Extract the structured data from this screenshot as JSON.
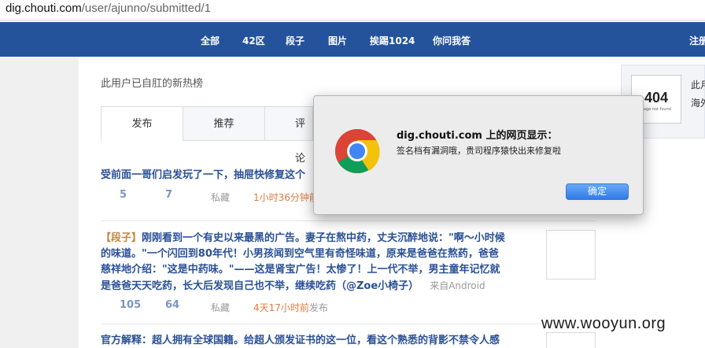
{
  "address_bar": {
    "host": "dig.chouti.com",
    "path": "/user/ajunno/submitted/1"
  },
  "nav": {
    "items": [
      "全部",
      "42区",
      "段子",
      "图片",
      "挨踢1024",
      "你问我答"
    ],
    "right_item": "注册"
  },
  "page": {
    "title": "此用户已自肛的新热榜",
    "tabs": [
      "发布",
      "推荐",
      "评论"
    ]
  },
  "posts": [
    {
      "title": "受前面一哥们启发玩了一下，抽屉快修复这个",
      "upvotes": "5",
      "comments": "7",
      "save": "私藏",
      "time": "1小时36分钟前"
    },
    {
      "tag": "【段子】",
      "title_lines": [
        "刚刚看到一个有史以来最黑的广告。妻子在熬中药，丈夫沉醉地说：\"啊～小时候",
        "的味道。\"一个闪回到80年代！小男孩闻到空气里有奇怪味道，原来是爸爸在熬药，爸爸",
        "慈祥地介绍：\"这是中药味。\"——这是肾宝广告！太惨了！上一代不举，男主童年记忆就",
        "是爸爸天天吃药，长大后发现自己也不举，继续吃药（@Zoe小椅子）"
      ],
      "source": "来自Android",
      "upvotes": "105",
      "comments": "64",
      "save": "私藏",
      "time": "4天17小时前",
      "time_suffix": "发布"
    },
    {
      "title": "官方解释：超人拥有全球国籍。给超人颁发证书的这一位，看这个熟悉的背影不禁令人感"
    }
  ],
  "right_panel": {
    "image_text": "404",
    "image_subtext": "Page not found",
    "line1": "此月",
    "line2": "海外"
  },
  "dialog": {
    "title": "dig.chouti.com 上的网页显示：",
    "message": "签名档有漏洞哦，贵司程序猿快出来修复啦",
    "ok_label": "确定",
    "icon": "chrome-logo-icon"
  },
  "watermark": "www.wooyun.org",
  "colors": {
    "nav_bg": "#24539c",
    "link": "#2a5096",
    "time": "#e07a3f",
    "tag": "#c5873c",
    "button": "#2f7be8"
  }
}
